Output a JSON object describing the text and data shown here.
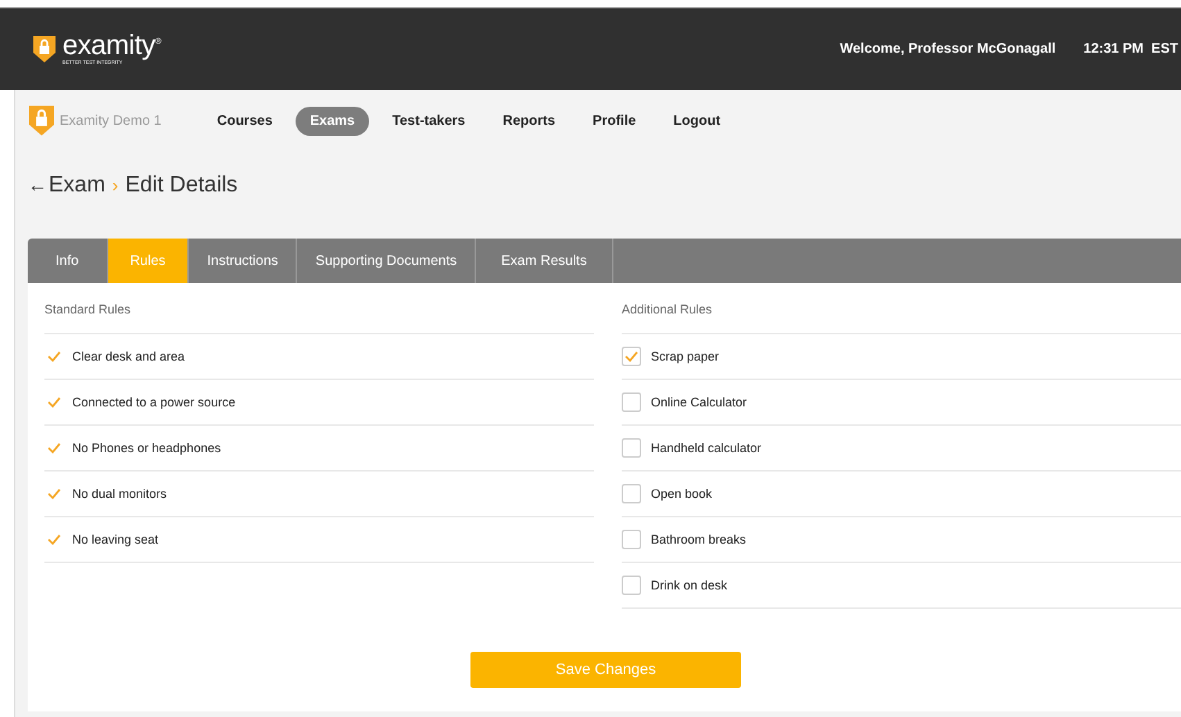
{
  "header": {
    "logo_text": "examity",
    "logo_mark": "®",
    "tagline": "BETTER TEST INTEGRITY",
    "welcome": "Welcome, Professor McGonagall",
    "time": "12:31 PM  EST"
  },
  "nav": {
    "org": "Examity Demo 1",
    "items": [
      {
        "label": "Courses",
        "selected": false
      },
      {
        "label": "Exams",
        "selected": true
      },
      {
        "label": "Test-takers",
        "selected": false
      },
      {
        "label": "Reports",
        "selected": false
      },
      {
        "label": "Profile",
        "selected": false
      },
      {
        "label": "Logout",
        "selected": false
      }
    ]
  },
  "breadcrumb": {
    "back": "←",
    "parent": "Exam",
    "separator": "›",
    "current": "Edit Details"
  },
  "tabs": [
    {
      "label": "Info",
      "selected": false
    },
    {
      "label": "Rules",
      "selected": true
    },
    {
      "label": "Instructions",
      "selected": false
    },
    {
      "label": "Supporting Documents",
      "selected": false
    },
    {
      "label": "Exam Results",
      "selected": false
    }
  ],
  "standard_rules": {
    "title": "Standard Rules",
    "items": [
      "Clear desk and area",
      "Connected to a power source",
      "No Phones or headphones",
      "No dual monitors",
      "No leaving seat"
    ]
  },
  "additional_rules": {
    "title": "Additional Rules",
    "items": [
      {
        "label": "Scrap paper",
        "checked": true
      },
      {
        "label": "Online Calculator",
        "checked": false
      },
      {
        "label": "Handheld calculator",
        "checked": false
      },
      {
        "label": "Open book",
        "checked": false
      },
      {
        "label": "Bathroom breaks",
        "checked": false
      },
      {
        "label": "Drink on desk",
        "checked": false
      }
    ]
  },
  "save_button": "Save Changes"
}
